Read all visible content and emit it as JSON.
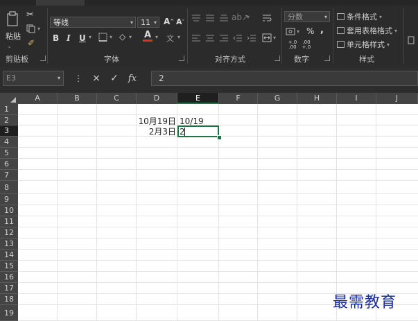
{
  "ribbon": {
    "clipboard": {
      "paste_label": "粘贴",
      "group_label": "剪贴板"
    },
    "font": {
      "font_name": "等线",
      "font_size": "11",
      "grow_label": "A",
      "shrink_label": "A",
      "bold_label": "B",
      "italic_label": "I",
      "underline_label": "U",
      "font_color_label": "A",
      "phonetic_label": "文",
      "group_label": "字体"
    },
    "alignment": {
      "group_label": "对齐方式"
    },
    "number": {
      "format": "分数",
      "percent_label": "%",
      "comma_label": ",",
      "increase_decimal": "+.0 .00",
      "decrease_decimal": ".00 +.0",
      "group_label": "数字"
    },
    "styles": {
      "conditional_label": "条件格式",
      "table_label": "套用表格格式",
      "cell_label": "单元格样式",
      "group_label": "样式"
    }
  },
  "formula_bar": {
    "name_box": "E3",
    "cancel_icon": "×",
    "enter_icon": "✓",
    "fx_label": "fx",
    "value": "2"
  },
  "grid": {
    "columns": [
      "A",
      "B",
      "C",
      "D",
      "E",
      "F",
      "G",
      "H",
      "I",
      "J"
    ],
    "rows": [
      "1",
      "2",
      "3",
      "4",
      "5",
      "6",
      "7",
      "8",
      "9",
      "10",
      "11",
      "12",
      "13",
      "14",
      "15",
      "16",
      "17",
      "18",
      "19"
    ],
    "selected_column": "E",
    "selected_row": "3",
    "cells": {
      "D2": "10月19日",
      "E2": "10/19",
      "D3": "2月3日",
      "E3": "2"
    }
  },
  "watermark": "最需教育"
}
